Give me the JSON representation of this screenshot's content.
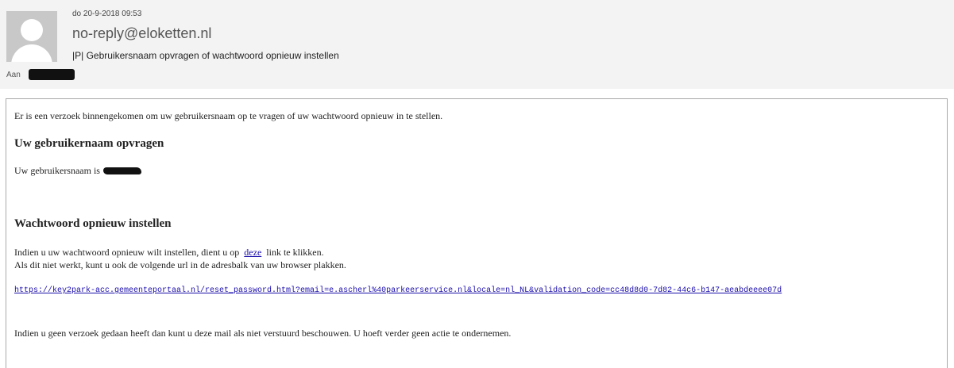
{
  "header": {
    "date": "do 20-9-2018 09:53",
    "sender": "no-reply@eloketten.nl",
    "subject": "|P| Gebruikersnaam opvragen of wachtwoord opnieuw instellen",
    "to_label": "Aan"
  },
  "body": {
    "intro": "Er is een verzoek binnengekomen om uw gebruikersnaam op te vragen of uw wachtwoord opnieuw in te stellen.",
    "heading_username": "Uw gebruikernaam opvragen",
    "username_text": "Uw gebruikersnaam is",
    "heading_reset": "Wachtwoord opnieuw instellen",
    "reset_text_before": "Indien u uw wachtwoord opnieuw wilt instellen, dient u op",
    "reset_link": "deze",
    "reset_text_after": "link te klikken.",
    "fallback_text": "Als dit niet werkt, kunt u ook de volgende url in de adresbalk van uw browser plakken.",
    "url": "https://key2park-acc.gemeenteportaal.nl/reset_password.html?email=e.ascherl%40parkeerservice.nl&locale=nl_NL&validation_code=cc48d8d0-7d82-44c6-b147-aeabdeeee07d",
    "closing": "Indien u geen verzoek gedaan heeft dan kunt u deze mail als niet verstuurd beschouwen. U hoeft verder geen actie te ondernemen."
  }
}
